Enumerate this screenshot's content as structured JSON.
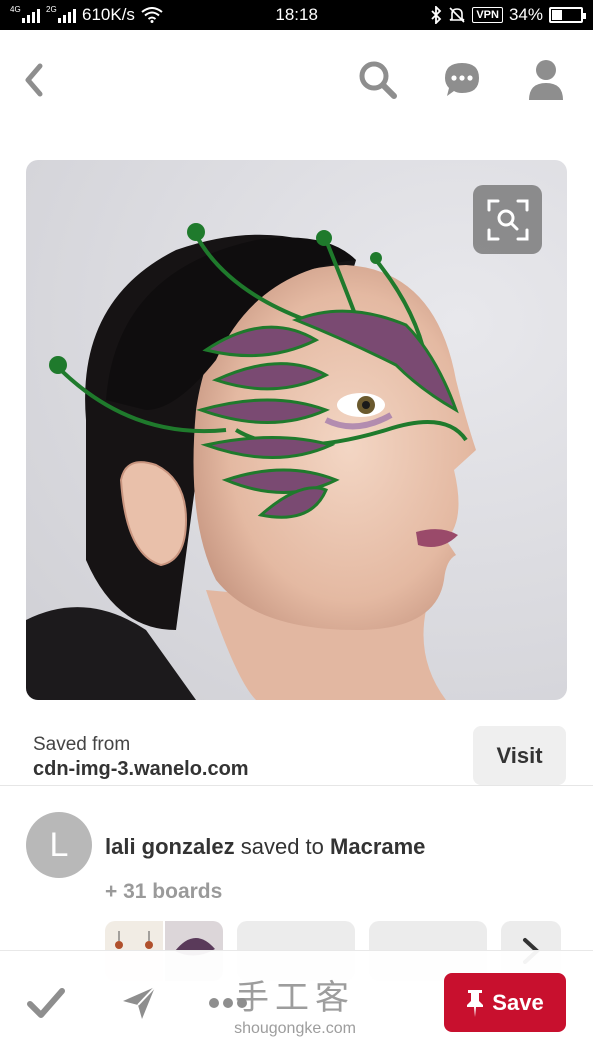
{
  "status_bar": {
    "network_a": "4G",
    "network_b": "2G",
    "speed": "610K/s",
    "time": "18:18",
    "vpn": "VPN",
    "battery": "34%",
    "battery_level": 0.34
  },
  "top_bar": {
    "back_icon": "chevron-left-icon",
    "search_icon": "search-icon",
    "comment_icon": "chat-bubble-icon",
    "profile_icon": "user-icon"
  },
  "pin": {
    "image_subject": "woman-wearing-beaded-wire-mask-photo",
    "visual_search_icon": "visual-search-icon"
  },
  "source": {
    "saved_from_label": "Saved from",
    "domain": "cdn-img-3.wanelo.com",
    "visit_label": "Visit"
  },
  "saver": {
    "avatar_letter": "L",
    "name": "lali gonzalez",
    "action": "saved to",
    "board": "Macrame",
    "boards_count": "+ 31 boards"
  },
  "bottom_bar": {
    "check_icon": "check-icon",
    "send_icon": "send-icon",
    "more_icon": "more-dots-icon",
    "save_label": "Save",
    "save_icon": "pushpin-icon"
  },
  "watermark": {
    "text_cn": "手工客",
    "url": "shougongke.com"
  },
  "colors": {
    "save_red": "#c8102e",
    "icon_gray": "#8e8e8e",
    "mask_green": "#1f7a2c",
    "bead_purple": "#7a4a72"
  }
}
